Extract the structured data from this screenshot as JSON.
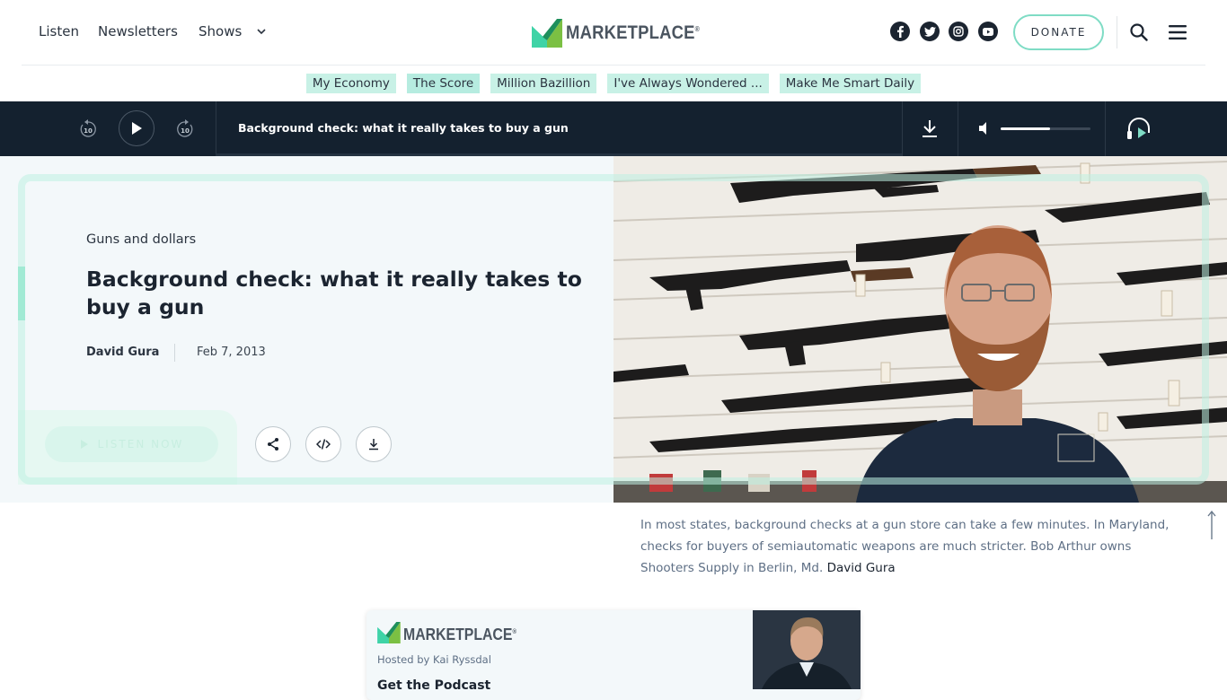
{
  "header": {
    "nav": [
      {
        "label": "Listen"
      },
      {
        "label": "Newsletters"
      },
      {
        "label": "Shows"
      }
    ],
    "logo_text": "MARKETPLACE",
    "logo_mark": "®",
    "donate_label": "DONATE",
    "social_icons": [
      "facebook-icon",
      "twitter-icon",
      "instagram-icon",
      "youtube-icon"
    ]
  },
  "topics": [
    {
      "label": "My Economy"
    },
    {
      "label": "The Score"
    },
    {
      "label": "Million Bazillion"
    },
    {
      "label": "I've Always Wondered ..."
    },
    {
      "label": "Make Me Smart Daily"
    }
  ],
  "player": {
    "skip_back": "10",
    "skip_forward": "10",
    "title": "Background check: what it really takes to buy a gun",
    "volume_level": 0.55
  },
  "article": {
    "kicker": "Guns and dollars",
    "headline": "Background check: what it really takes to buy a gun",
    "author": "David Gura",
    "date": "Feb 7, 2013",
    "listen_label": "LISTEN NOW"
  },
  "photo": {
    "caption": "In most states, background checks at a gun store can take a few minutes. In Maryland, checks for buyers of semiautomatic weapons are much stricter. Bob Arthur owns Shooters Supply in Berlin, Md.",
    "credit": "David Gura"
  },
  "promo": {
    "logo_text": "MARKETPLACE",
    "logo_mark": "®",
    "host": "Hosted by Kai Ryssdal",
    "cta": "Get the Podcast"
  },
  "colors": {
    "accent": "#7fdcc5",
    "player_bg": "#14212f",
    "pill_bg": "#c8f1e6",
    "navy": "#1b2430"
  }
}
